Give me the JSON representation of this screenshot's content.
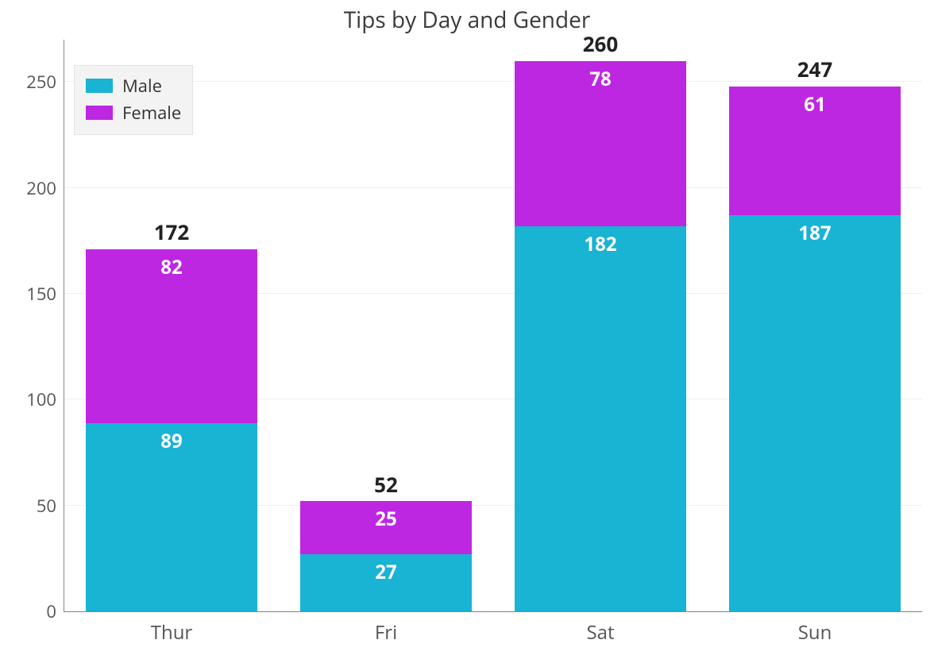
{
  "chart_data": {
    "type": "bar",
    "stacked": true,
    "title": "Tips by Day and Gender",
    "xlabel": "",
    "ylabel": "",
    "categories": [
      "Thur",
      "Fri",
      "Sat",
      "Sun"
    ],
    "series": [
      {
        "name": "Male",
        "color": "#19b3d3",
        "values": [
          89,
          27,
          182,
          187
        ]
      },
      {
        "name": "Female",
        "color": "#be27e1",
        "values": [
          82,
          25,
          78,
          61
        ]
      }
    ],
    "totals": [
      172,
      52,
      260,
      247
    ],
    "yticks": [
      0,
      50,
      100,
      150,
      200,
      250
    ],
    "ylim": [
      0,
      270
    ],
    "legend_position": "top-left"
  },
  "legend": {
    "male": "Male",
    "female": "Female"
  }
}
